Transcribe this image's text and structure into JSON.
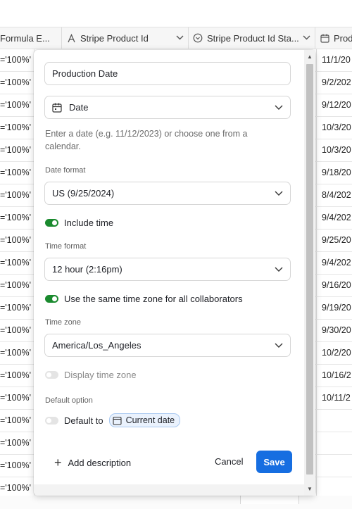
{
  "grid": {
    "headers": [
      {
        "label": "Formula E...",
        "icon": "formula-icon"
      },
      {
        "label": "Stripe Product Id",
        "icon": "text-field-icon"
      },
      {
        "label": "Stripe Product Id Sta...",
        "icon": "status-icon"
      },
      {
        "label": "Prod",
        "icon": "calendar-icon"
      }
    ],
    "rows": [
      {
        "formula": "='100%'",
        "prod": "11/1/20"
      },
      {
        "formula": "='100%'",
        "prod": "9/2/202"
      },
      {
        "formula": "='100%'",
        "prod": "9/12/20"
      },
      {
        "formula": "='100%'",
        "prod": "10/3/20"
      },
      {
        "formula": "='100%'",
        "prod": "10/3/20"
      },
      {
        "formula": "='100%'",
        "prod": "9/18/20"
      },
      {
        "formula": "='100%'",
        "prod": "8/4/202"
      },
      {
        "formula": "='100%'",
        "prod": "9/4/202"
      },
      {
        "formula": "='100%'",
        "prod": "9/25/20"
      },
      {
        "formula": "='100%'",
        "prod": "9/4/202"
      },
      {
        "formula": "='100%'",
        "prod": "9/16/20"
      },
      {
        "formula": "='100%'",
        "prod": "9/19/20"
      },
      {
        "formula": "='100%'",
        "prod": "9/30/20"
      },
      {
        "formula": "='100%'",
        "prod": "10/2/20"
      },
      {
        "formula": "='100%'",
        "prod": "10/16/2"
      },
      {
        "formula": "='100%'",
        "prod": "10/11/2"
      },
      {
        "formula": "='100%'",
        "prod": ""
      },
      {
        "formula": "='100%'",
        "prod": ""
      },
      {
        "formula": "='100%'",
        "prod": ""
      },
      {
        "formula": "='100%'",
        "prod": ""
      }
    ]
  },
  "field_editor": {
    "name_value": "Production Date",
    "type_label": "Date",
    "type_icon": "calendar-icon",
    "hint": "Enter a date (e.g. 11/12/2023) or choose one from a calendar.",
    "date_format_label": "Date format",
    "date_format_value": "US (9/25/2024)",
    "include_time_label": "Include time",
    "include_time_on": true,
    "time_format_label": "Time format",
    "time_format_value": "12 hour (2:16pm)",
    "same_tz_label": "Use the same time zone for all collaborators",
    "same_tz_on": true,
    "time_zone_label": "Time zone",
    "time_zone_value": "America/Los_Angeles",
    "display_tz_label": "Display time zone",
    "display_tz_on": false,
    "default_option_label": "Default option",
    "default_to_label": "Default to",
    "default_to_on": false,
    "current_date_chip": "Current date",
    "add_description_label": "Add description",
    "cancel_label": "Cancel",
    "save_label": "Save"
  },
  "colors": {
    "toggle_on": "#1a8a2e",
    "save_button": "#166ee1",
    "chip_border": "#a8c8f0"
  }
}
